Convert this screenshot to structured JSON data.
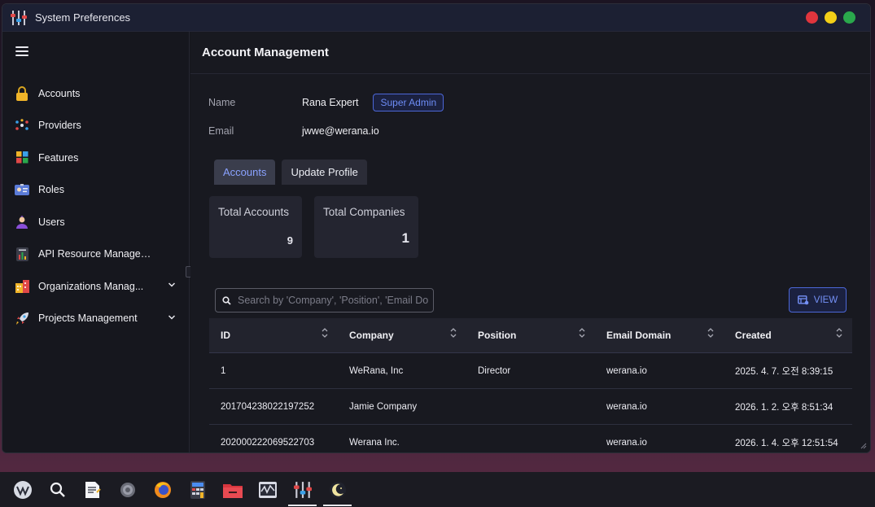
{
  "window": {
    "title": "System Preferences"
  },
  "sidebar": {
    "items": [
      {
        "label": "Accounts",
        "icon": "lock-icon"
      },
      {
        "label": "Providers",
        "icon": "network-icon"
      },
      {
        "label": "Features",
        "icon": "grid-icon"
      },
      {
        "label": "Roles",
        "icon": "id-card-icon"
      },
      {
        "label": "Users",
        "icon": "user-icon"
      },
      {
        "label": "API Resource Management",
        "icon": "api-icon"
      },
      {
        "label": "Organizations Manag...",
        "icon": "building-icon",
        "expandable": true
      },
      {
        "label": "Projects Management",
        "icon": "rocket-icon",
        "expandable": true
      }
    ]
  },
  "main": {
    "title": "Account Management",
    "profile": {
      "name_label": "Name",
      "name_value": "Rana Expert",
      "role_badge": "Super Admin",
      "email_label": "Email",
      "email_value": "jwwe@werana.io"
    },
    "tabs": [
      {
        "label": "Accounts",
        "active": true
      },
      {
        "label": "Update Profile",
        "active": false
      }
    ],
    "stats": [
      {
        "title": "Total Accounts",
        "value": "9"
      },
      {
        "title": "Total Companies",
        "value": "1"
      }
    ],
    "search": {
      "placeholder": "Search by 'Company', 'Position', 'Email Domain'",
      "value": ""
    },
    "view_button": "VIEW",
    "table": {
      "columns": [
        "ID",
        "Company",
        "Position",
        "Email Domain",
        "Created"
      ],
      "rows": [
        [
          "1",
          "WeRana, Inc",
          "Director",
          "werana.io",
          "2025. 4. 7. 오전 8:39:15"
        ],
        [
          "201704238022197252",
          "Jamie Company",
          "",
          "werana.io",
          "2026. 1. 2. 오후 8:51:34"
        ],
        [
          "202000222069522703",
          "Werana Inc.",
          "",
          "werana.io",
          "2026. 1. 4. 오후 12:51:54"
        ]
      ]
    }
  },
  "colors": {
    "accent": "#6d8cf5",
    "window_bg": "#181920",
    "sidebar_bg": "#16171e",
    "titlebar_bg": "#1c2033",
    "close": "#e0353d",
    "minimize": "#f3cf17",
    "maximize": "#2aa84c"
  },
  "taskbar": {
    "apps": [
      {
        "icon": "start-menu-icon",
        "running": false
      },
      {
        "icon": "search-icon",
        "running": false
      },
      {
        "icon": "text-editor-icon",
        "running": false
      },
      {
        "icon": "settings-icon",
        "running": false
      },
      {
        "icon": "firefox-icon",
        "running": false
      },
      {
        "icon": "calculator-icon",
        "running": false
      },
      {
        "icon": "files-icon",
        "running": false
      },
      {
        "icon": "system-monitor-icon",
        "running": false
      },
      {
        "icon": "system-preferences-icon",
        "running": true
      },
      {
        "icon": "night-mode-icon",
        "running": true
      }
    ]
  }
}
